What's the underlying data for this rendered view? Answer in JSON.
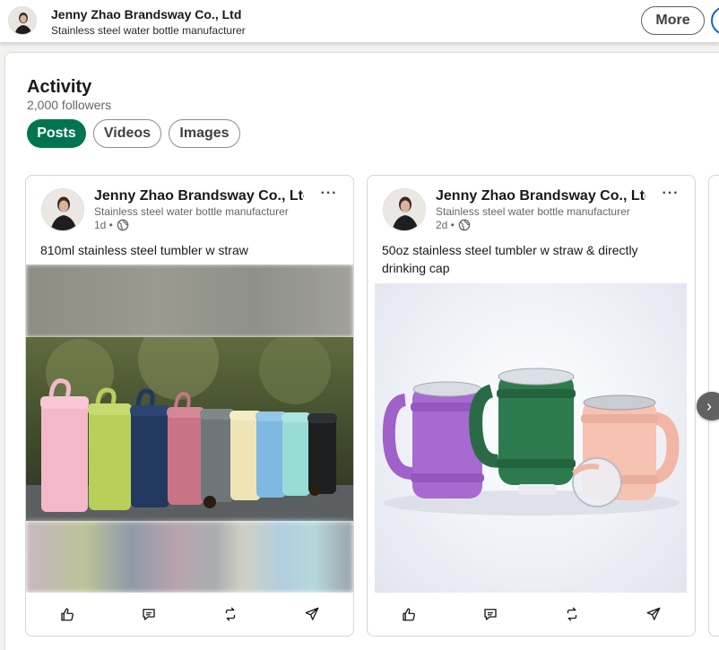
{
  "header": {
    "company_name": "Jenny Zhao Brandsway Co., Ltd",
    "tagline": "Stainless steel water bottle manufacturer",
    "more_label": "More"
  },
  "activity": {
    "title": "Activity",
    "followers": "2,000 followers",
    "tabs": [
      {
        "label": "Posts",
        "active": true
      },
      {
        "label": "Videos",
        "active": false
      },
      {
        "label": "Images",
        "active": false
      }
    ]
  },
  "posts": [
    {
      "author": "Jenny Zhao Brandsway Co., Ltd",
      "subtitle": "Stainless steel water bottle manufacturer",
      "time": "1d •",
      "text": "810ml stainless steel tumbler w straw",
      "image": "Colorful stainless steel tumblers with straws lined up on a table"
    },
    {
      "author": "Jenny Zhao Brandsway Co., Ltd",
      "subtitle": "Stainless steel water bottle manufacturer",
      "time": "2d •",
      "text": "50oz stainless steel tumbler w straw & directly drinking cap",
      "image": "Purple, green and pink stainless steel mugs with handles"
    }
  ],
  "actions": [
    "like-icon",
    "comment-icon",
    "repost-icon",
    "send-icon"
  ],
  "colors": {
    "active_tab": "#01754f",
    "accent": "#0a66c2",
    "page_bg": "#f4f2ee"
  }
}
